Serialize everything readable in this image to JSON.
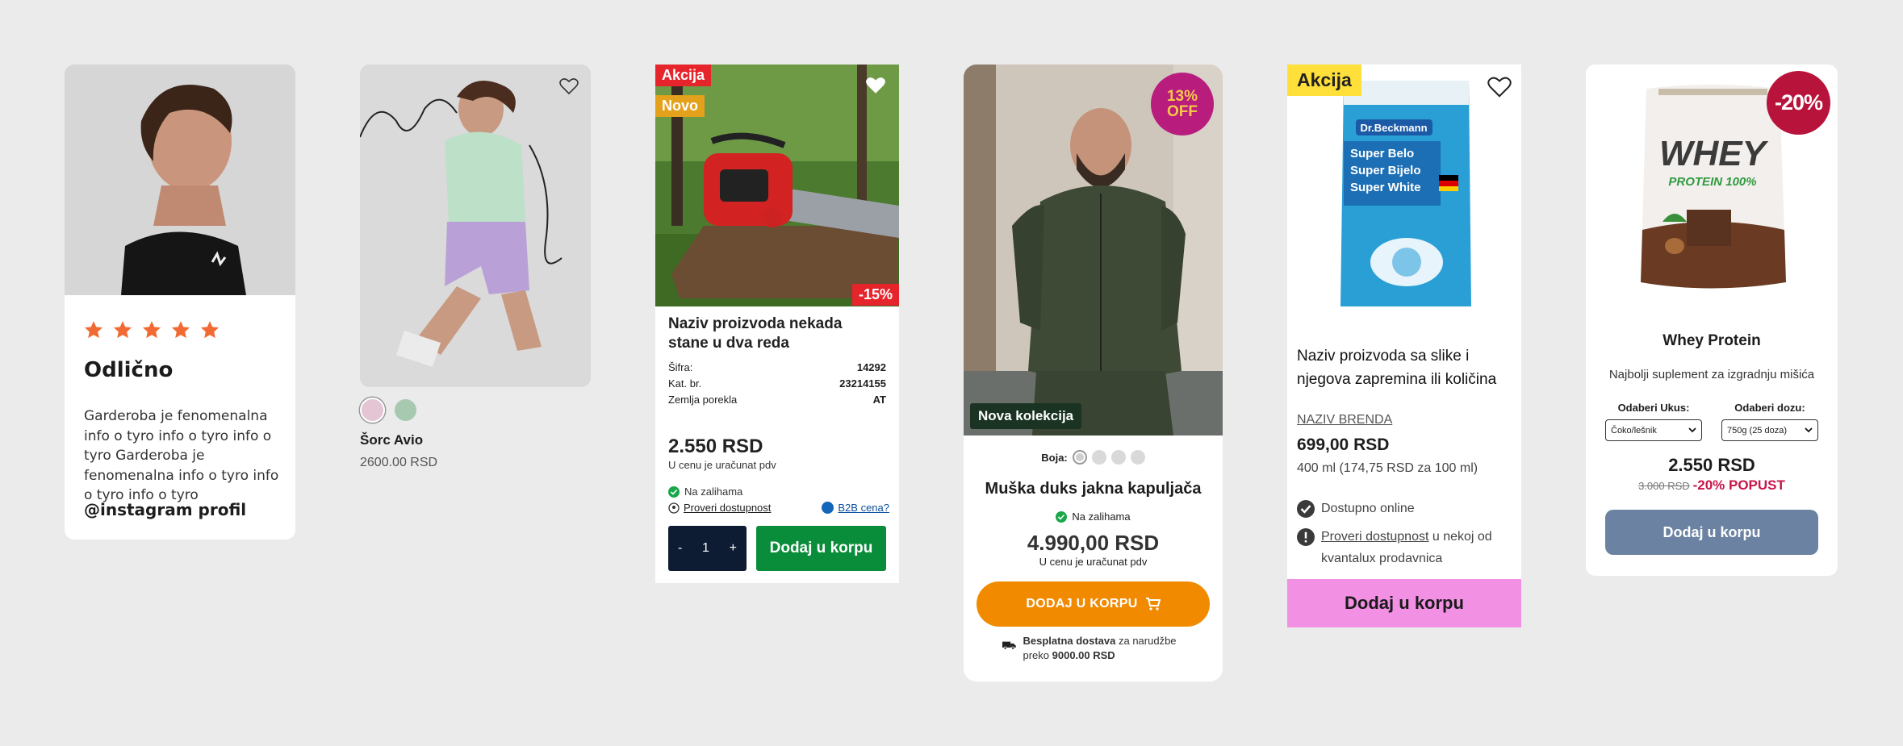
{
  "card1": {
    "title": "Odlično",
    "description": "Garderoba je fenomenalna info o tyro info o tyro info o tyro Garderoba je fenomenalna info o tyro info o tyro info o tyro",
    "instagram": "@instagram profil",
    "rating": 5
  },
  "card2": {
    "name": "Šorc Avio",
    "price": "2600.00 RSD",
    "swatch_colors": [
      "#e3c5d3",
      "#a6c9b0"
    ]
  },
  "card3": {
    "badge_sale": "Akcija",
    "badge_new": "Novo",
    "discount": "-15%",
    "name": "Naziv proizvoda nekada stane u dva reda",
    "specs": [
      {
        "label": "Šifra:",
        "value": "14292"
      },
      {
        "label": "Kat. br.",
        "value": "23214155"
      },
      {
        "label": "Zemlja porekla",
        "value": "AT"
      }
    ],
    "price": "2.550 RSD",
    "vat_note": "U cenu je uračunat pdv",
    "stock": "Na zalihama",
    "check_availability": "Proveri dostupnost",
    "b2b": "B2B cena?",
    "qty_minus": "-",
    "qty_value": "1",
    "qty_plus": "+",
    "add_to_cart": "Dodaj u korpu"
  },
  "card4": {
    "off_line1": "13%",
    "off_line2": "OFF",
    "collection": "Nova kolekcija",
    "color_label": "Boja:",
    "name": "Muška duks jakna kapuljača",
    "stock": "Na zalihama",
    "price": "4.990,00 RSD",
    "vat_note": "U cenu je uračunat pdv",
    "add_to_cart": "DODAJ U KORPU",
    "ship_bold": "Besplatna dostava",
    "ship_mid": " za narudžbe preko ",
    "ship_amount": "9000.00 RSD"
  },
  "card5": {
    "badge": "Akcija",
    "package_brand": "Dr.Beckmann",
    "package_lines": [
      "Super Belo",
      "Super Bijelo",
      "Super White"
    ],
    "name": "Naziv proizvoda sa slike i njegova zapremina ili količina",
    "brand": "NAZIV BRENDA",
    "price": "699,00 RSD",
    "unit_price": "400 ml (174,75 RSD za 100 ml)",
    "online": "Dostupno online",
    "check_link": "Proveri dostupnost",
    "check_rest": " u nekoj od kvantalux prodavnica",
    "add_to_cart": "Dodaj u korpu"
  },
  "card6": {
    "discount": "-20%",
    "package_title": "WHEY",
    "package_sub": "PROTEIN 100%",
    "name": "Whey Protein",
    "description": "Najbolji suplement za izgradnju mišića",
    "flavor_label": "Odaberi Ukus:",
    "flavor_value": "Čoko/lešnik",
    "dose_label": "Odaberi dozu:",
    "dose_value": "750g (25 doza)",
    "price": "2.550 RSD",
    "old_price": "3.000 RSD",
    "promo": "-20% POPUST",
    "add_to_cart": "Dodaj u korpu"
  }
}
